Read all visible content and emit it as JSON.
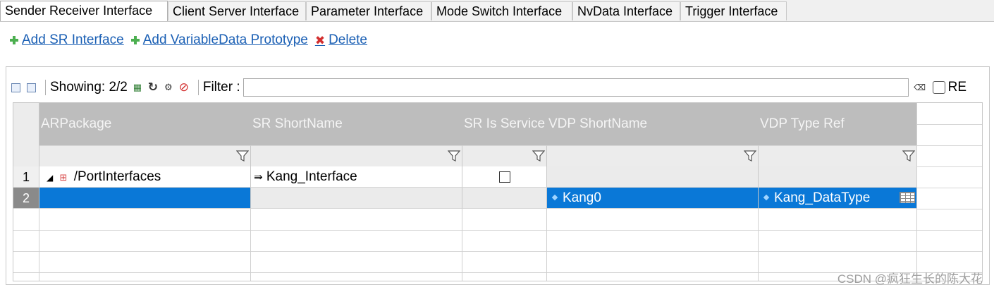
{
  "tabs": [
    "Sender Receiver Interface",
    "Client Server Interface",
    "Parameter Interface",
    "Mode Switch Interface",
    "NvData Interface",
    "Trigger Interface"
  ],
  "actions": {
    "add_sr": "Add SR Interface",
    "add_vdp": "Add VariableData Prototype",
    "delete": "Delete"
  },
  "toolbar": {
    "showing": "Showing: 2/2",
    "filter_label": "Filter :",
    "filter_value": "",
    "re_label": "RE"
  },
  "columns": [
    "ARPackage",
    "SR ShortName",
    "SR Is Service",
    "VDP ShortName",
    "VDP Type Ref"
  ],
  "rows": [
    {
      "num": "1",
      "arpackage": "/PortInterfaces",
      "sr_shortname": "Kang_Interface",
      "sr_is_service": false,
      "vdp_shortname": "",
      "vdp_type_ref": ""
    },
    {
      "num": "2",
      "arpackage": "",
      "sr_shortname": "",
      "sr_is_service": null,
      "vdp_shortname": "Kang0",
      "vdp_type_ref": "Kang_DataType"
    }
  ],
  "watermark": "CSDN @疯狂生长的陈大花",
  "colors": {
    "selection": "#0a78d7",
    "header": "#bdbdbd",
    "link": "#1a5fb4"
  }
}
